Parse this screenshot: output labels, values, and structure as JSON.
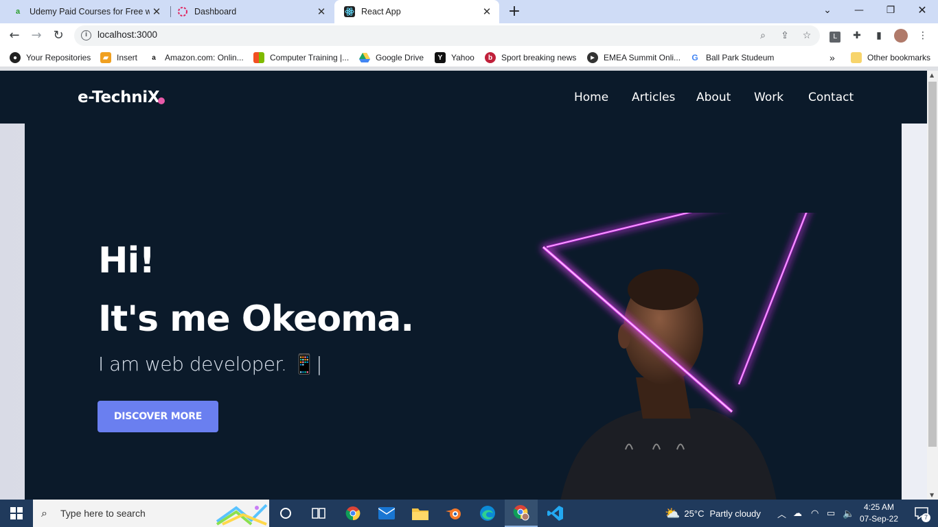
{
  "browser": {
    "tabs": [
      {
        "title": "Udemy Paid Courses for Free wit",
        "favicon": "udemy-icon",
        "active": false
      },
      {
        "title": "Dashboard",
        "favicon": "dashboard-icon",
        "active": false
      },
      {
        "title": "React App",
        "favicon": "react-icon",
        "active": true
      }
    ],
    "url": "localhost:3000",
    "bookmarks": [
      "Your Repositories",
      "Insert",
      "Amazon.com: Onlin...",
      "Computer Training |...",
      "Google Drive",
      "Yahoo",
      "Sport breaking news",
      "EMEA Summit Onli...",
      "Ball Park Studeum"
    ],
    "other_bookmarks": "Other bookmarks",
    "overflow": "»",
    "extension_letter": "L"
  },
  "site": {
    "logo": "e-TechniX",
    "nav": [
      "Home",
      "Articles",
      "About",
      "Work",
      "Contact"
    ],
    "hero": {
      "greeting": "Hi!",
      "intro": "It's me Okeoma.",
      "role": "I am web developer. 📱|",
      "cta": "DISCOVER MORE"
    },
    "colors": {
      "background": "#0b1a2a",
      "accent": "#e75aa8",
      "button": "#6a7ff0",
      "neon": "#d63ef0"
    }
  },
  "taskbar": {
    "search_placeholder": "Type here to search",
    "weather_temp": "25°C",
    "weather_desc": "Partly cloudy",
    "time": "4:25 AM",
    "date": "07-Sep-22",
    "notification_count": "7"
  }
}
